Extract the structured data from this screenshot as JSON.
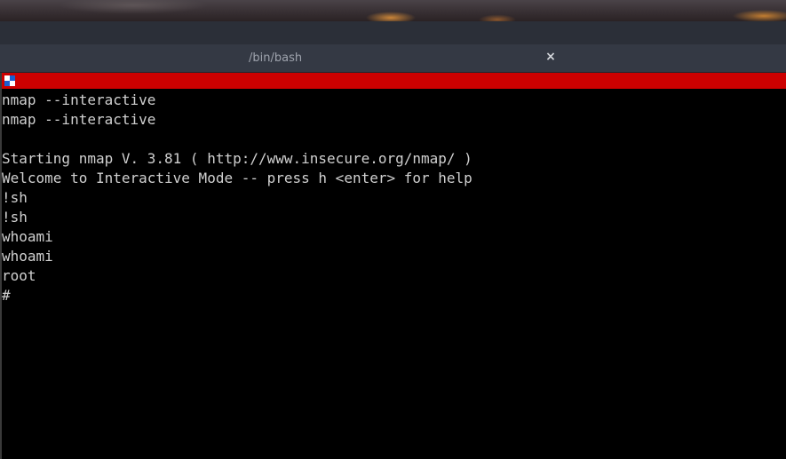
{
  "tab": {
    "title": "/bin/bash",
    "close_symbol": "×"
  },
  "terminal": {
    "lines": [
      "nmap --interactive",
      "nmap --interactive",
      "",
      "Starting nmap V. 3.81 ( http://www.insecure.org/nmap/ )",
      "Welcome to Interactive Mode -- press h <enter> for help",
      "!sh",
      "!sh",
      "whoami",
      "whoami",
      "root",
      "#"
    ]
  },
  "colors": {
    "title_strip": "#cc0000",
    "terminal_bg": "#000000",
    "terminal_fg": "#d0d0d0",
    "tab_bar": "#343944"
  },
  "icons": {
    "window_icon": "terminal-window-icon",
    "close_icon": "close-icon"
  }
}
